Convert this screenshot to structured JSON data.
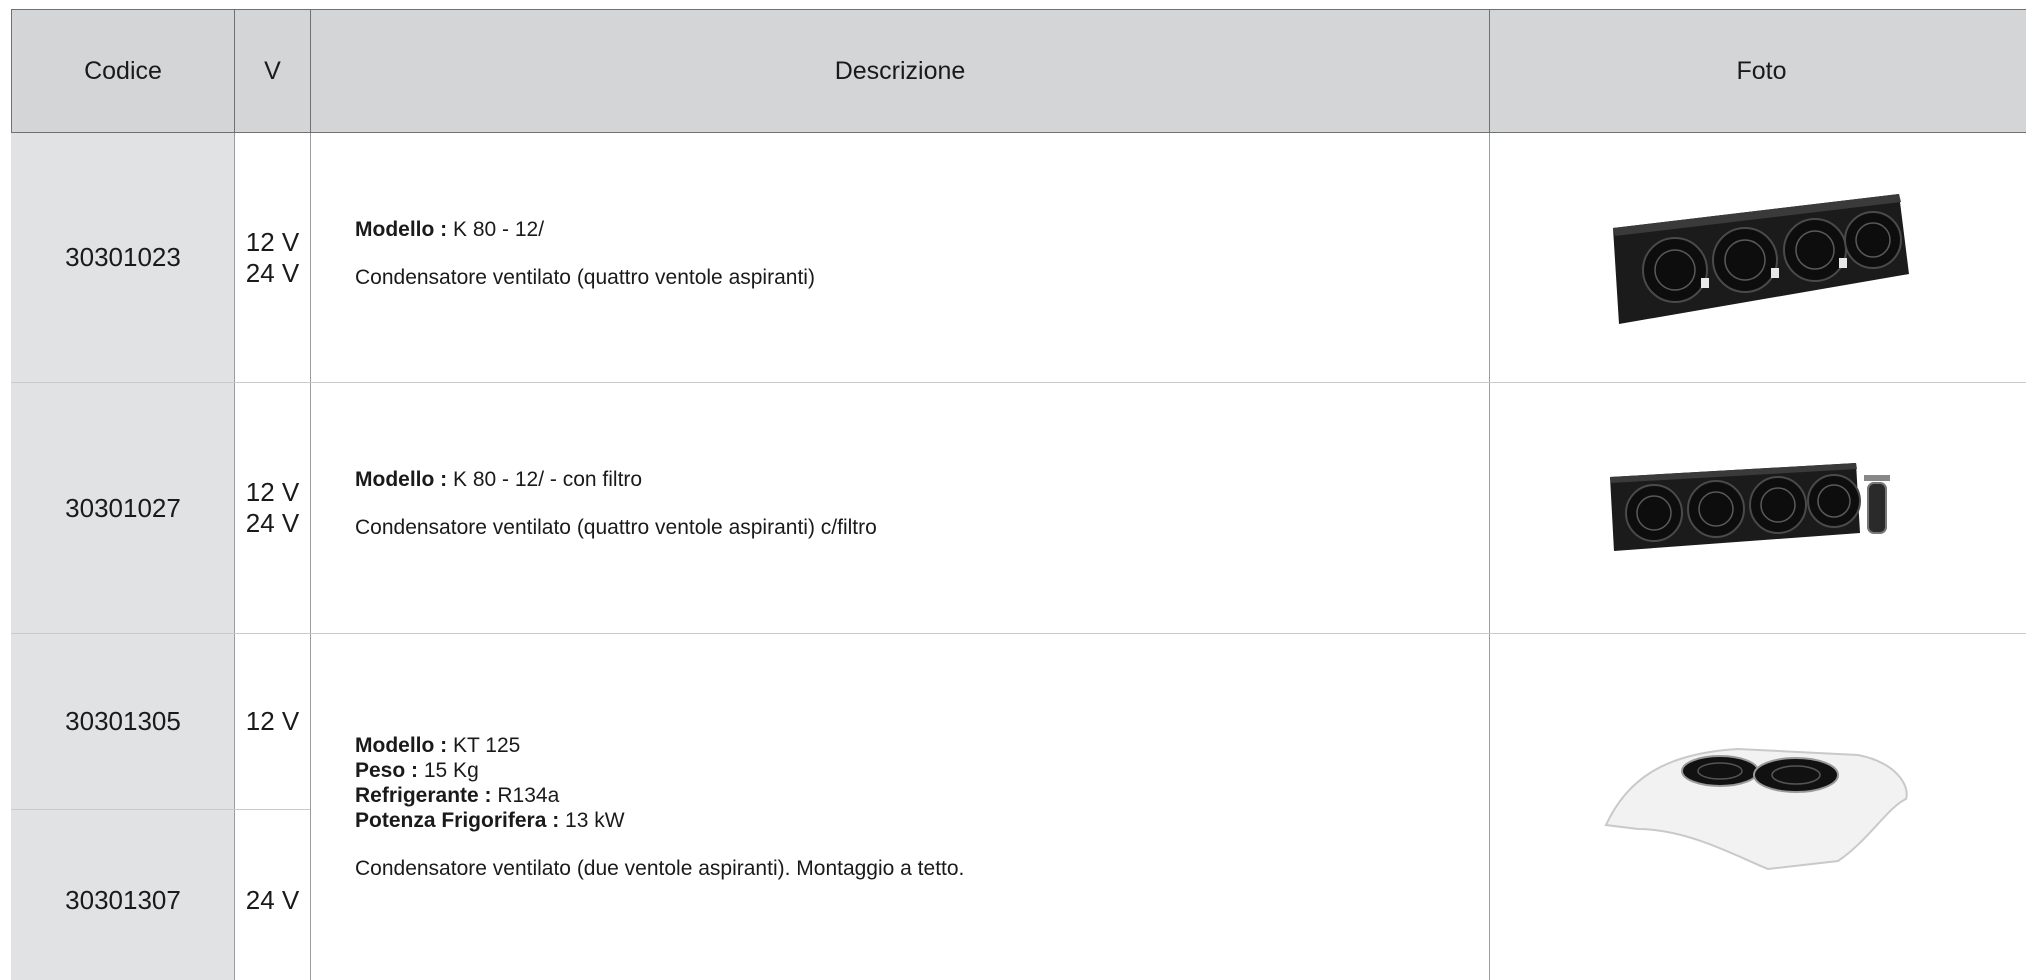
{
  "headers": {
    "codice": "Codice",
    "v": "V",
    "descrizione": "Descrizione",
    "foto": "Foto"
  },
  "rows": [
    {
      "code": "30301023",
      "v1": "12 V",
      "v2": "24 V",
      "model_label": "Modello :",
      "model_value": " K 80 - 12/",
      "note": "Condensatore ventilato (quattro ventole aspiranti)",
      "photo": "condenser-4-fans-photo"
    },
    {
      "code": "30301027",
      "v1": "12 V",
      "v2": "24 V",
      "model_label": "Modello :",
      "model_value": " K 80 - 12/ - con filtro",
      "note": "Condensatore ventilato (quattro ventole aspiranti) c/filtro",
      "photo": "condenser-4-fans-filter-photo"
    },
    {
      "code_a": "30301305",
      "v_a": "12 V",
      "code_b": "30301307",
      "v_b": "24 V",
      "model_label": "Modello :",
      "model_value": " KT 125",
      "peso_label": "Peso :",
      "peso_value": " 15 Kg",
      "refr_label": "Refrigerante :",
      "refr_value": " R134a",
      "pot_label": "Potenza Frigorifera :",
      "pot_value": " 13 kW",
      "note": "Condensatore ventilato (due ventole aspiranti). Montaggio a tetto.",
      "photo": "roof-condenser-2-fans-photo"
    }
  ],
  "colors": {
    "header_bg": "#d4d5d6",
    "code_bg": "#e1e2e3",
    "border": "#9a9b9d"
  }
}
